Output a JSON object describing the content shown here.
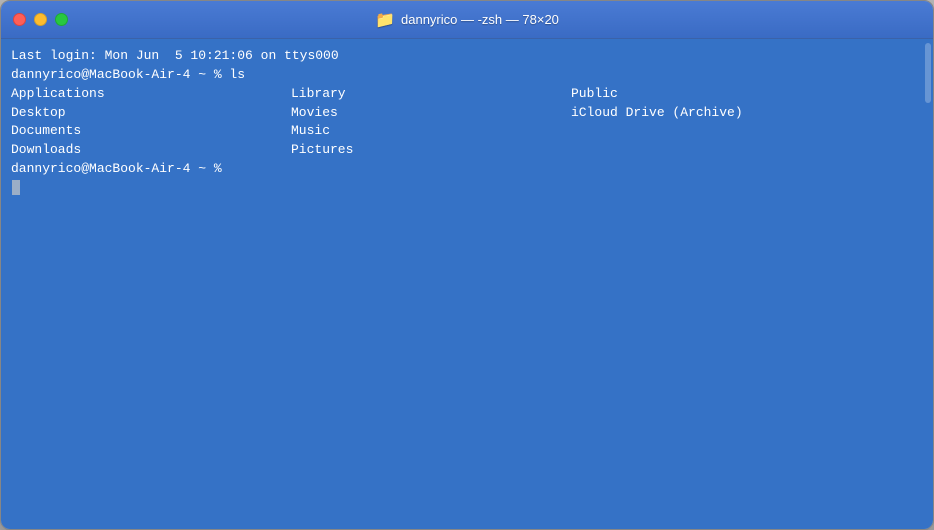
{
  "window": {
    "title": "dannyrico — -zsh — 78×20",
    "bg_color": "#3572c6"
  },
  "titlebar": {
    "title": "dannyrico — -zsh — 78×20",
    "folder_icon": "📁"
  },
  "traffic_lights": {
    "close_label": "close",
    "minimize_label": "minimize",
    "maximize_label": "maximize"
  },
  "terminal": {
    "line1": "Last login: Mon Jun  5 10:21:06 on ttys000",
    "line2": "dannyrico@MacBook-Air-4 ~ % ls",
    "prompt": "dannyrico@MacBook-Air-4 ~ % ",
    "ls_items": [
      {
        "col": 1,
        "name": "Applications"
      },
      {
        "col": 2,
        "name": "Library"
      },
      {
        "col": 3,
        "name": "Public"
      },
      {
        "col": 1,
        "name": "Desktop"
      },
      {
        "col": 2,
        "name": "Movies"
      },
      {
        "col": 3,
        "name": "iCloud Drive (Archive)"
      },
      {
        "col": 1,
        "name": "Documents"
      },
      {
        "col": 2,
        "name": "Music"
      },
      {
        "col": 3,
        "name": ""
      },
      {
        "col": 1,
        "name": "Downloads"
      },
      {
        "col": 2,
        "name": "Pictures"
      },
      {
        "col": 3,
        "name": ""
      }
    ],
    "col1": [
      "Applications",
      "Desktop",
      "Documents",
      "Downloads"
    ],
    "col2": [
      "Library",
      "Movies",
      "Music",
      "Pictures"
    ],
    "col3": [
      "Public",
      "iCloud Drive (Archive)",
      "",
      ""
    ]
  }
}
